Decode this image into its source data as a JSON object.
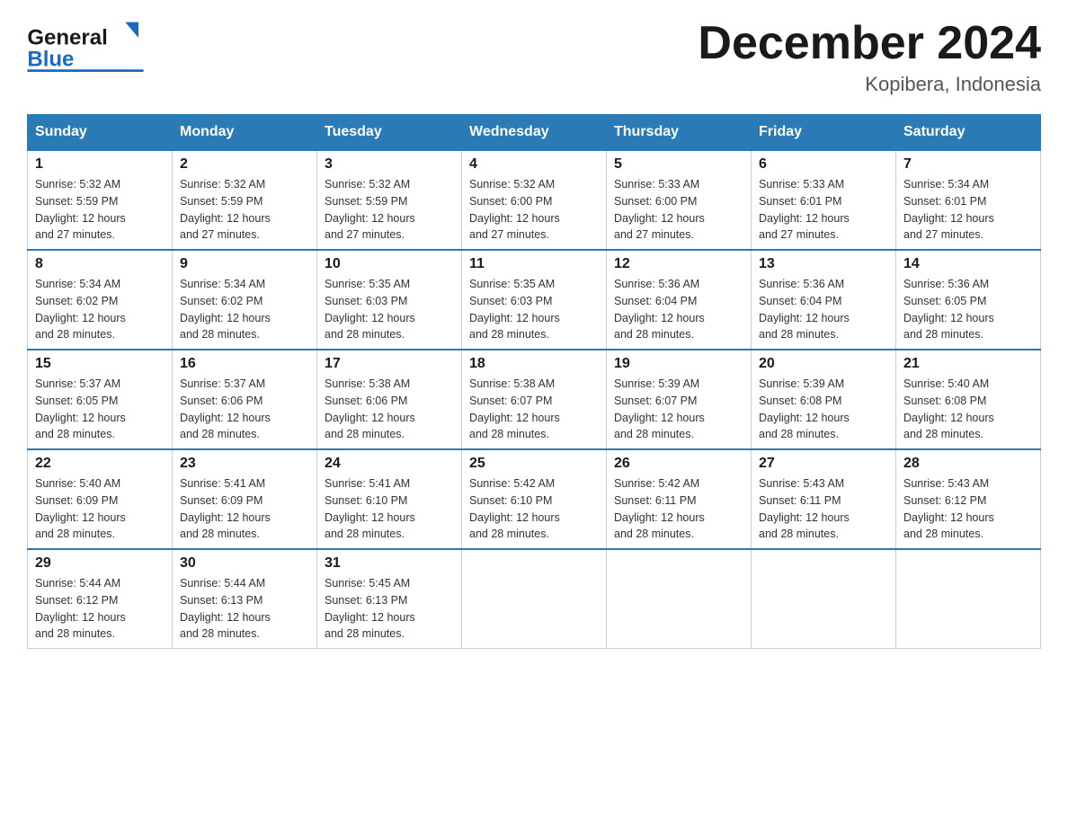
{
  "header": {
    "logo_text_general": "General",
    "logo_text_blue": "Blue",
    "month_title": "December 2024",
    "location": "Kopibera, Indonesia"
  },
  "days_of_week": [
    "Sunday",
    "Monday",
    "Tuesday",
    "Wednesday",
    "Thursday",
    "Friday",
    "Saturday"
  ],
  "weeks": [
    [
      {
        "day": "1",
        "sunrise": "5:32 AM",
        "sunset": "5:59 PM",
        "daylight": "12 hours and 27 minutes."
      },
      {
        "day": "2",
        "sunrise": "5:32 AM",
        "sunset": "5:59 PM",
        "daylight": "12 hours and 27 minutes."
      },
      {
        "day": "3",
        "sunrise": "5:32 AM",
        "sunset": "5:59 PM",
        "daylight": "12 hours and 27 minutes."
      },
      {
        "day": "4",
        "sunrise": "5:32 AM",
        "sunset": "6:00 PM",
        "daylight": "12 hours and 27 minutes."
      },
      {
        "day": "5",
        "sunrise": "5:33 AM",
        "sunset": "6:00 PM",
        "daylight": "12 hours and 27 minutes."
      },
      {
        "day": "6",
        "sunrise": "5:33 AM",
        "sunset": "6:01 PM",
        "daylight": "12 hours and 27 minutes."
      },
      {
        "day": "7",
        "sunrise": "5:34 AM",
        "sunset": "6:01 PM",
        "daylight": "12 hours and 27 minutes."
      }
    ],
    [
      {
        "day": "8",
        "sunrise": "5:34 AM",
        "sunset": "6:02 PM",
        "daylight": "12 hours and 28 minutes."
      },
      {
        "day": "9",
        "sunrise": "5:34 AM",
        "sunset": "6:02 PM",
        "daylight": "12 hours and 28 minutes."
      },
      {
        "day": "10",
        "sunrise": "5:35 AM",
        "sunset": "6:03 PM",
        "daylight": "12 hours and 28 minutes."
      },
      {
        "day": "11",
        "sunrise": "5:35 AM",
        "sunset": "6:03 PM",
        "daylight": "12 hours and 28 minutes."
      },
      {
        "day": "12",
        "sunrise": "5:36 AM",
        "sunset": "6:04 PM",
        "daylight": "12 hours and 28 minutes."
      },
      {
        "day": "13",
        "sunrise": "5:36 AM",
        "sunset": "6:04 PM",
        "daylight": "12 hours and 28 minutes."
      },
      {
        "day": "14",
        "sunrise": "5:36 AM",
        "sunset": "6:05 PM",
        "daylight": "12 hours and 28 minutes."
      }
    ],
    [
      {
        "day": "15",
        "sunrise": "5:37 AM",
        "sunset": "6:05 PM",
        "daylight": "12 hours and 28 minutes."
      },
      {
        "day": "16",
        "sunrise": "5:37 AM",
        "sunset": "6:06 PM",
        "daylight": "12 hours and 28 minutes."
      },
      {
        "day": "17",
        "sunrise": "5:38 AM",
        "sunset": "6:06 PM",
        "daylight": "12 hours and 28 minutes."
      },
      {
        "day": "18",
        "sunrise": "5:38 AM",
        "sunset": "6:07 PM",
        "daylight": "12 hours and 28 minutes."
      },
      {
        "day": "19",
        "sunrise": "5:39 AM",
        "sunset": "6:07 PM",
        "daylight": "12 hours and 28 minutes."
      },
      {
        "day": "20",
        "sunrise": "5:39 AM",
        "sunset": "6:08 PM",
        "daylight": "12 hours and 28 minutes."
      },
      {
        "day": "21",
        "sunrise": "5:40 AM",
        "sunset": "6:08 PM",
        "daylight": "12 hours and 28 minutes."
      }
    ],
    [
      {
        "day": "22",
        "sunrise": "5:40 AM",
        "sunset": "6:09 PM",
        "daylight": "12 hours and 28 minutes."
      },
      {
        "day": "23",
        "sunrise": "5:41 AM",
        "sunset": "6:09 PM",
        "daylight": "12 hours and 28 minutes."
      },
      {
        "day": "24",
        "sunrise": "5:41 AM",
        "sunset": "6:10 PM",
        "daylight": "12 hours and 28 minutes."
      },
      {
        "day": "25",
        "sunrise": "5:42 AM",
        "sunset": "6:10 PM",
        "daylight": "12 hours and 28 minutes."
      },
      {
        "day": "26",
        "sunrise": "5:42 AM",
        "sunset": "6:11 PM",
        "daylight": "12 hours and 28 minutes."
      },
      {
        "day": "27",
        "sunrise": "5:43 AM",
        "sunset": "6:11 PM",
        "daylight": "12 hours and 28 minutes."
      },
      {
        "day": "28",
        "sunrise": "5:43 AM",
        "sunset": "6:12 PM",
        "daylight": "12 hours and 28 minutes."
      }
    ],
    [
      {
        "day": "29",
        "sunrise": "5:44 AM",
        "sunset": "6:12 PM",
        "daylight": "12 hours and 28 minutes."
      },
      {
        "day": "30",
        "sunrise": "5:44 AM",
        "sunset": "6:13 PM",
        "daylight": "12 hours and 28 minutes."
      },
      {
        "day": "31",
        "sunrise": "5:45 AM",
        "sunset": "6:13 PM",
        "daylight": "12 hours and 28 minutes."
      },
      null,
      null,
      null,
      null
    ]
  ],
  "labels": {
    "sunrise": "Sunrise:",
    "sunset": "Sunset:",
    "daylight": "Daylight:"
  }
}
